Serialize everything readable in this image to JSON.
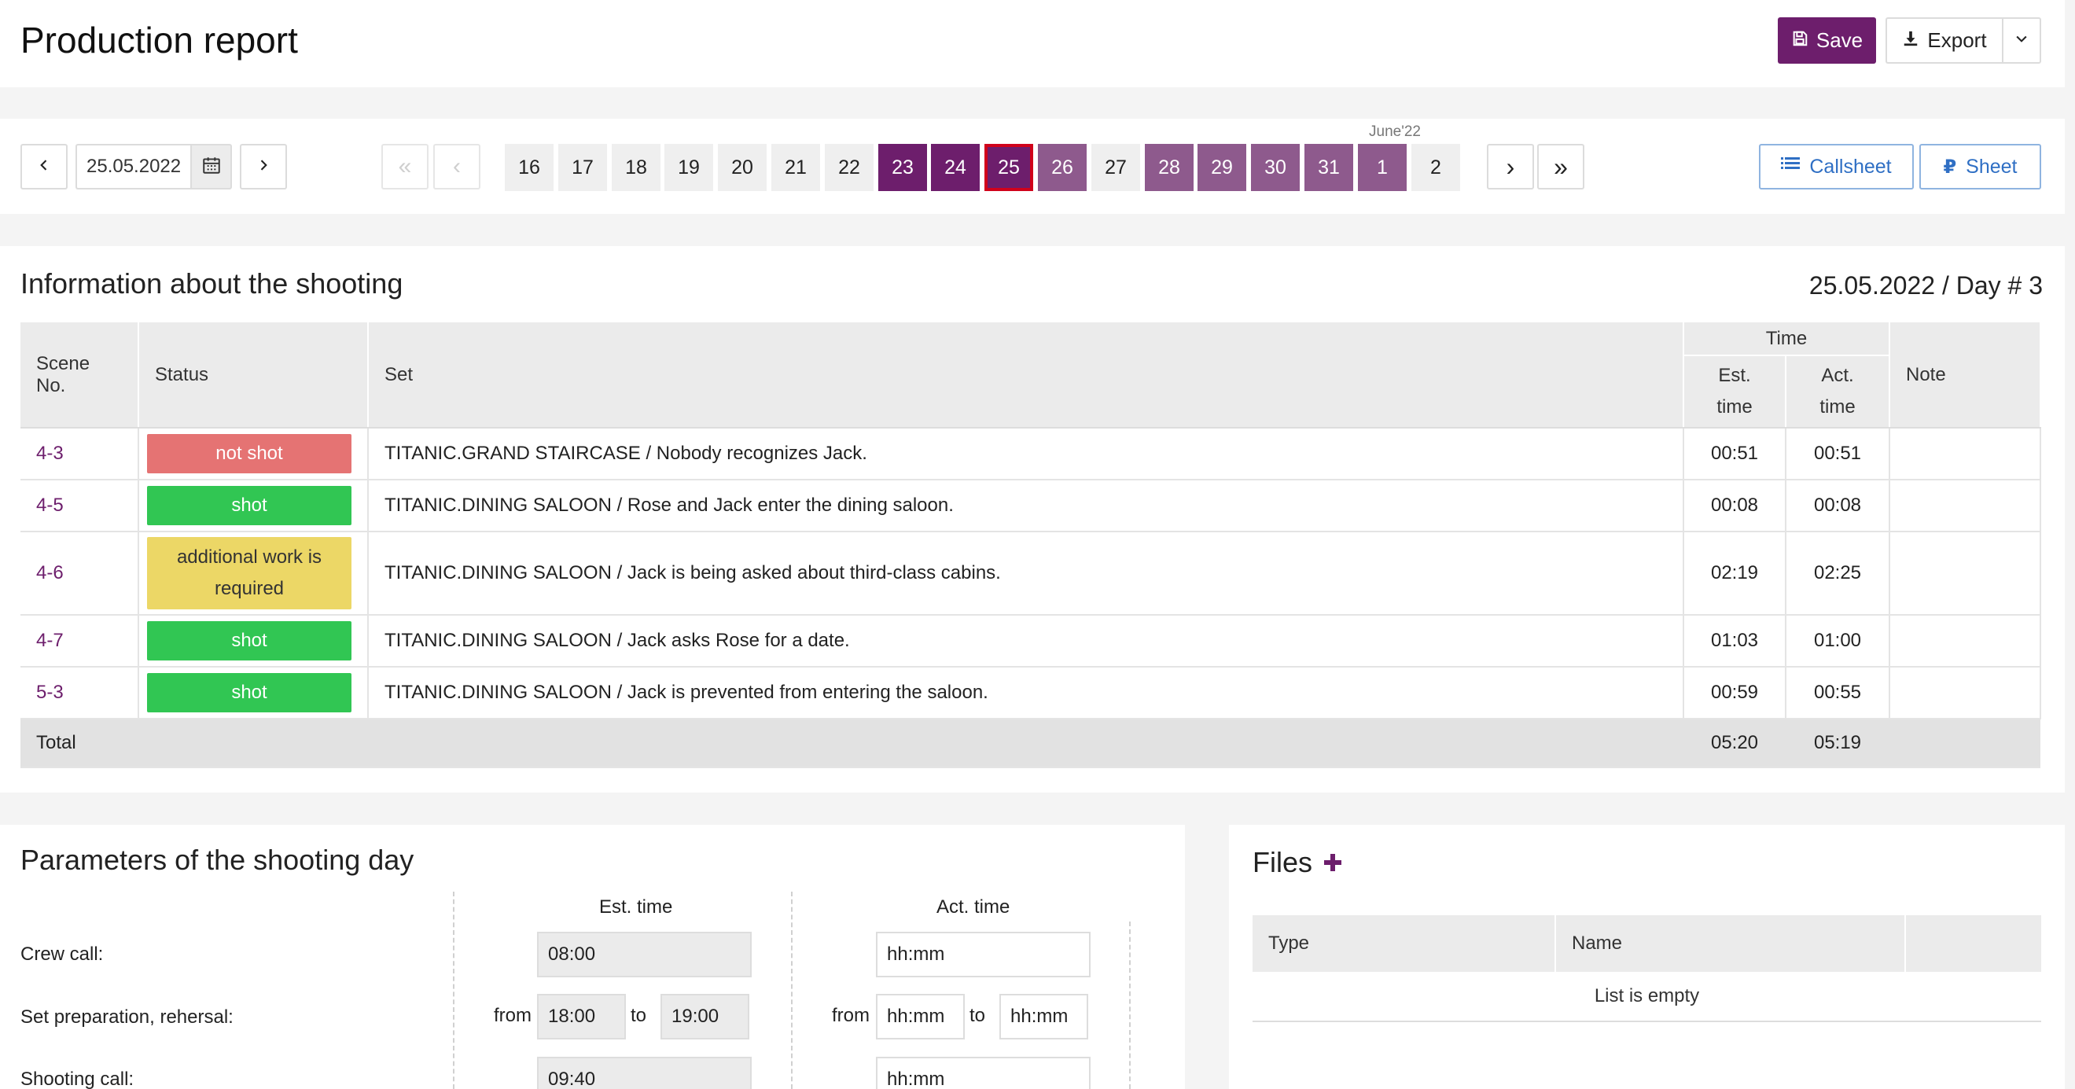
{
  "header": {
    "title": "Production report",
    "save_label": "Save",
    "export_label": "Export"
  },
  "datebar": {
    "date": "25.05.2022",
    "month_label": "June'22",
    "days": [
      {
        "label": "16",
        "state": "plain"
      },
      {
        "label": "17",
        "state": "plain"
      },
      {
        "label": "18",
        "state": "plain"
      },
      {
        "label": "19",
        "state": "plain"
      },
      {
        "label": "20",
        "state": "plain"
      },
      {
        "label": "21",
        "state": "plain"
      },
      {
        "label": "22",
        "state": "plain"
      },
      {
        "label": "23",
        "state": "dark"
      },
      {
        "label": "24",
        "state": "dark"
      },
      {
        "label": "25",
        "state": "selected"
      },
      {
        "label": "26",
        "state": "light"
      },
      {
        "label": "27",
        "state": "plain"
      },
      {
        "label": "28",
        "state": "light"
      },
      {
        "label": "29",
        "state": "light"
      },
      {
        "label": "30",
        "state": "light"
      },
      {
        "label": "31",
        "state": "light"
      },
      {
        "label": "1",
        "state": "light"
      },
      {
        "label": "2",
        "state": "plain"
      }
    ],
    "callsheet_label": "Callsheet",
    "sheet_label": "Sheet"
  },
  "info": {
    "title": "Information about the shooting",
    "day_label": "25.05.2022 / Day # 3",
    "columns": {
      "scene": "Scene No.",
      "status": "Status",
      "set": "Set",
      "time": "Time",
      "est_line1": "Est.",
      "est_line2": "time",
      "act_line1": "Act.",
      "act_line2": "time",
      "note": "Note"
    },
    "rows": [
      {
        "scene": "4-3",
        "status": "not shot",
        "status_kind": "notshot",
        "set": "TITANIC.GRAND STAIRCASE / Nobody recognizes Jack.",
        "est": "00:51",
        "act": "00:51",
        "note": ""
      },
      {
        "scene": "4-5",
        "status": "shot",
        "status_kind": "shot",
        "set": "TITANIC.DINING SALOON / Rose and Jack enter the dining saloon.",
        "est": "00:08",
        "act": "00:08",
        "note": ""
      },
      {
        "scene": "4-6",
        "status": "additional work is required",
        "status_kind": "add",
        "set": "TITANIC.DINING SALOON / Jack is being asked about third-class cabins.",
        "est": "02:19",
        "act": "02:25",
        "note": ""
      },
      {
        "scene": "4-7",
        "status": "shot",
        "status_kind": "shot",
        "set": "TITANIC.DINING SALOON / Jack asks Rose for a date.",
        "est": "01:03",
        "act": "01:00",
        "note": ""
      },
      {
        "scene": "5-3",
        "status": "shot",
        "status_kind": "shot",
        "set": "TITANIC.DINING SALOON / Jack is prevented from entering the saloon.",
        "est": "00:59",
        "act": "00:55",
        "note": ""
      }
    ],
    "total": {
      "label": "Total",
      "est": "05:20",
      "act": "05:19"
    }
  },
  "params": {
    "title": "Parameters of the shooting day",
    "est_head": "Est. time",
    "act_head": "Act. time",
    "from_label": "from",
    "to_label": "to",
    "crew_call": {
      "label": "Crew call:",
      "est": "08:00",
      "act_placeholder": "hh:mm"
    },
    "set_prep": {
      "label": "Set preparation, rehersal:",
      "est_from": "18:00",
      "est_to": "19:00",
      "act_from_placeholder": "hh:mm",
      "act_to_placeholder": "hh:mm"
    },
    "shooting_call": {
      "label": "Shooting call:",
      "est": "09:40",
      "act_placeholder": "hh:mm"
    }
  },
  "files": {
    "title": "Files",
    "col_type": "Type",
    "col_name": "Name",
    "empty": "List is empty"
  },
  "colors": {
    "brand": "#6d1e6c",
    "brand_light": "#8e5a8d",
    "selected_border": "#d0021b",
    "shot": "#31c653",
    "not_shot": "#e57373",
    "additional": "#ecd766",
    "link_blue": "#2f6fc4"
  }
}
